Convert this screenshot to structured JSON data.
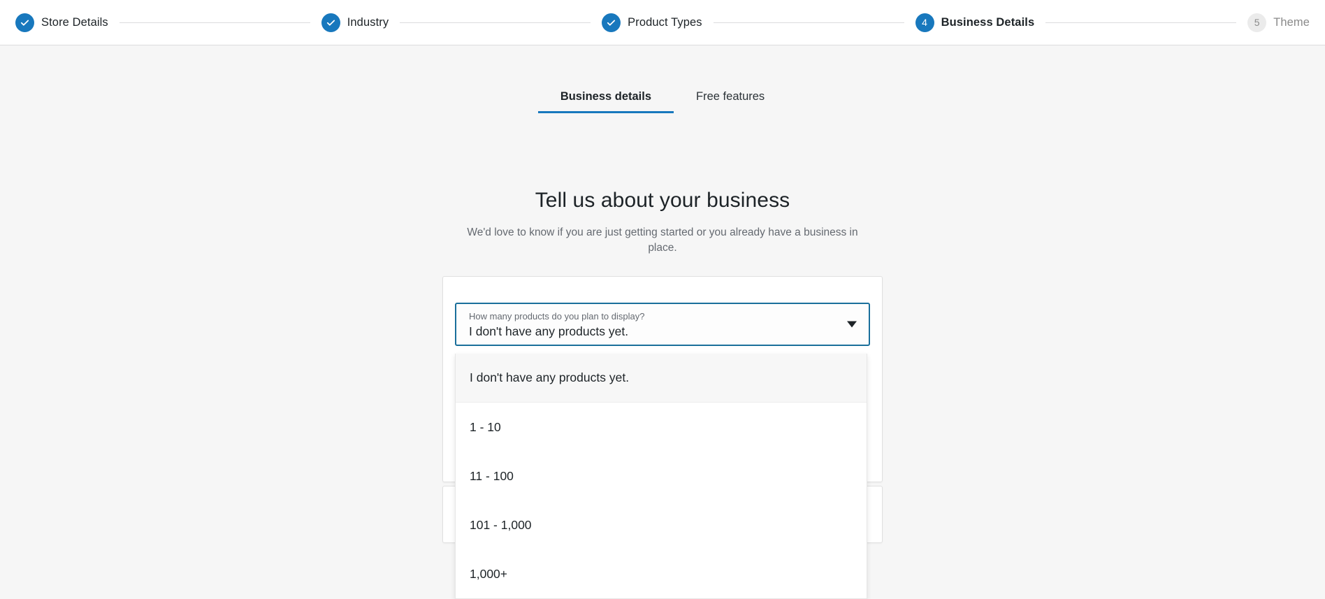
{
  "stepper": {
    "steps": [
      {
        "label": "Store Details",
        "marker": "check",
        "state": "done"
      },
      {
        "label": "Industry",
        "marker": "check",
        "state": "done"
      },
      {
        "label": "Product Types",
        "marker": "check",
        "state": "done"
      },
      {
        "label": "Business Details",
        "marker": "4",
        "state": "current"
      },
      {
        "label": "Theme",
        "marker": "5",
        "state": "upcoming"
      }
    ]
  },
  "tabs": [
    {
      "label": "Business details",
      "active": true
    },
    {
      "label": "Free features",
      "active": false
    }
  ],
  "heading": {
    "title": "Tell us about your business",
    "subtitle": "We'd love to know if you are just getting started or you already have a business in place."
  },
  "select": {
    "label": "How many products do you plan to display?",
    "value": "I don't have any products yet.",
    "arrow_icon": "chevron-down-icon",
    "expanded": true,
    "options": [
      "I don't have any products yet.",
      "1 - 10",
      "11 - 100",
      "101 - 1,000",
      "1,000+"
    ],
    "selected_index": 0
  },
  "colors": {
    "accent": "#1878bd",
    "focus_border": "#1a6f9b",
    "page_background": "#f6f6f6",
    "card_background": "#ffffff",
    "muted_text": "#646970"
  }
}
